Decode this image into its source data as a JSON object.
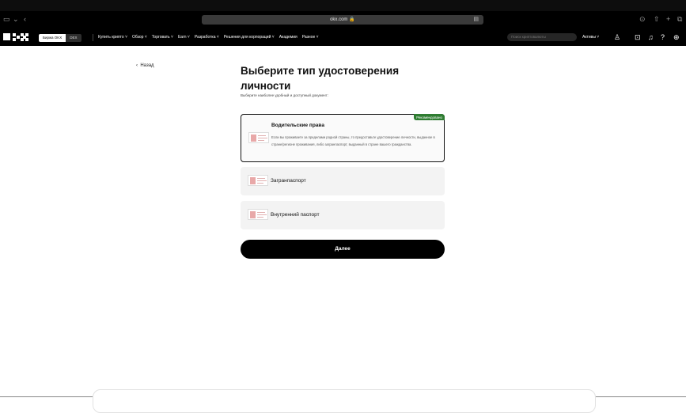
{
  "browser": {
    "url": "okx.com",
    "sidebar_icon": "sidebar-icon",
    "back_icon": "chevron-left-icon",
    "share_icon": "share-icon",
    "new_tab_icon": "plus-icon",
    "tabs_icon": "tabs-icon",
    "download_icon": "download-icon"
  },
  "nav": {
    "segment_exchange": "Биржа OKX",
    "segment_dex": "DEX",
    "menu": [
      "Купить крипто ˅",
      "Обзор ˅",
      "Торговать ˅",
      "Earn ˅",
      "Разработка ˅",
      "Решения для корпораций ˅",
      "Академия",
      "Разное ˅"
    ],
    "search_placeholder": "Поиск криптовалюты",
    "assets": "Активы ˅"
  },
  "page": {
    "back": "Назад",
    "title": "Выберите тип удостоверения личности",
    "subtitle": "Выберите наиболее удобный и доступный документ:",
    "options": [
      {
        "title": "Водительские права",
        "badge": "Рекомендовано",
        "description": "Если вы проживаете за пределами родной страны, то предоставьте удостоверение личности, выданное в стране/регионе проживания, либо загранпаспорт, выданный в стране вашего гражданства.",
        "selected": true
      },
      {
        "title": "Загранпаспорт",
        "selected": false
      },
      {
        "title": "Внутренний паспорт",
        "selected": false
      }
    ],
    "next_button": "Далее"
  },
  "colors": {
    "accent": "#000000",
    "badge": "#2f7d32"
  }
}
